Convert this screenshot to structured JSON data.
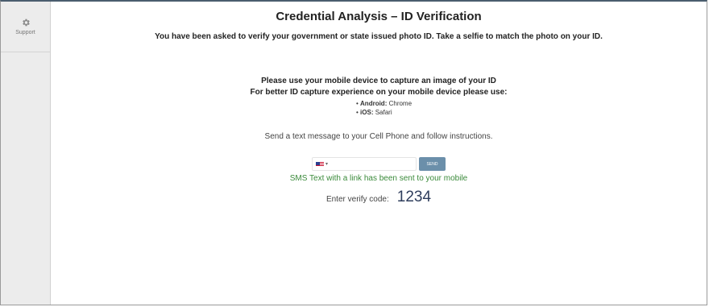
{
  "sidebar": {
    "support_label": "Support",
    "support_icon": "gear-icon"
  },
  "main": {
    "title": "Credential Analysis – ID Verification",
    "subtitle": "You have been asked to verify your government or state issued photo ID. Take a selfie to match the photo on your ID.",
    "capture_line1": "Please use your mobile device to capture an image of your ID",
    "capture_line2": "For better ID capture experience on your mobile device please use:",
    "browsers": [
      {
        "platform": "Android:",
        "browser": "Chrome"
      },
      {
        "platform": "iOS:",
        "browser": "Safari"
      }
    ],
    "sms_instruction": "Send a text message to your Cell Phone and follow instructions.",
    "phone": {
      "country_flag": "us-flag",
      "value": ""
    },
    "send_label": "SEND",
    "sms_sent_message": "SMS Text with a link has been sent to your mobile",
    "verify_label": "Enter verify code:",
    "verify_code": "1234"
  },
  "colors": {
    "send_button": "#6b8faa",
    "success_text": "#3a8a3a",
    "code_text": "#2e3d5c",
    "top_border": "#4a5d6e"
  }
}
